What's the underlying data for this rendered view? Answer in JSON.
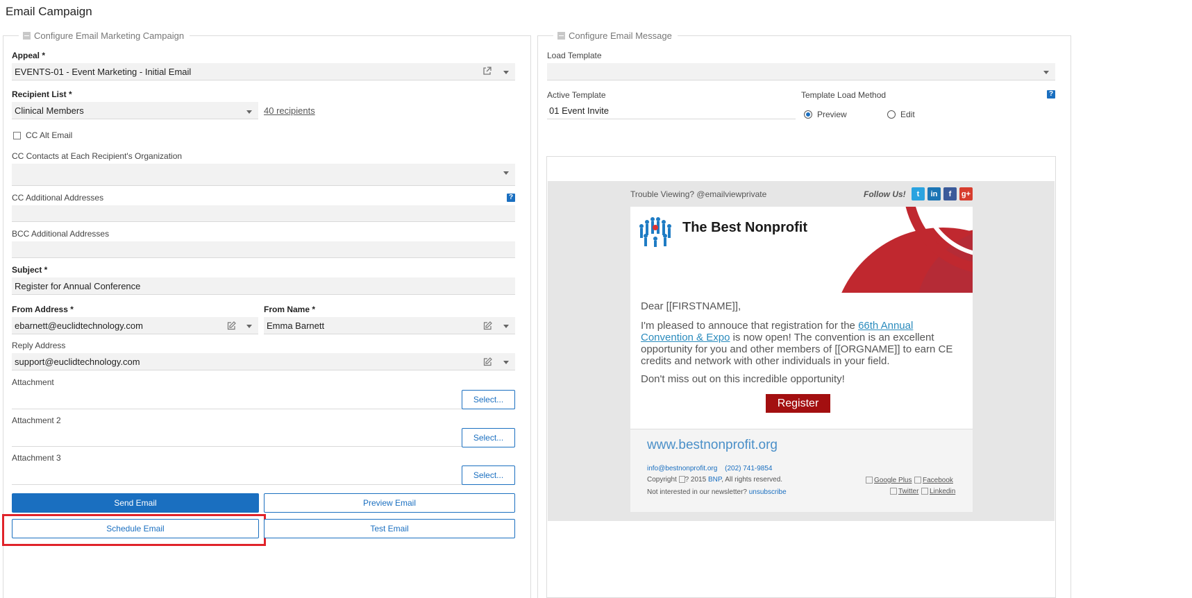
{
  "page_title": "Email Campaign",
  "left": {
    "legend": "Configure Email Marketing Campaign",
    "appeal": {
      "label": "Appeal *",
      "value": "EVENTS-01 - Event Marketing - Initial Email"
    },
    "recipient_list": {
      "label": "Recipient List *",
      "value": "Clinical Members",
      "count_link": "40 recipients"
    },
    "cc_alt_email": {
      "label": "CC Alt Email",
      "checked": false
    },
    "cc_contacts": {
      "label": "CC Contacts at Each Recipient's Organization",
      "value": ""
    },
    "cc_additional": {
      "label": "CC Additional Addresses",
      "value": ""
    },
    "bcc_additional": {
      "label": "BCC Additional Addresses",
      "value": ""
    },
    "subject": {
      "label": "Subject *",
      "value": "Register for Annual Conference"
    },
    "from_address": {
      "label": "From Address *",
      "value": "ebarnett@euclidtechnology.com"
    },
    "from_name": {
      "label": "From Name *",
      "value": "Emma Barnett"
    },
    "reply_address": {
      "label": "Reply Address",
      "value": "support@euclidtechnology.com"
    },
    "attachments": [
      {
        "label": "Attachment",
        "button": "Select..."
      },
      {
        "label": "Attachment 2",
        "button": "Select..."
      },
      {
        "label": "Attachment 3",
        "button": "Select..."
      }
    ],
    "buttons": {
      "send": "Send Email",
      "preview": "Preview Email",
      "schedule": "Schedule Email",
      "test": "Test Email"
    }
  },
  "right": {
    "legend": "Configure Email Message",
    "load_template": {
      "label": "Load Template",
      "value": ""
    },
    "active_template": {
      "label": "Active Template",
      "value": "01 Event Invite"
    },
    "load_method": {
      "label": "Template Load Method",
      "options": [
        "Preview",
        "Edit"
      ],
      "selected": "Preview"
    }
  },
  "email": {
    "trouble": "Trouble Viewing? @emailviewprivate",
    "follow": "Follow Us!",
    "social": [
      {
        "name": "twitter-icon",
        "glyph": "t",
        "color": "#2aa3e0"
      },
      {
        "name": "linkedin-icon",
        "glyph": "in",
        "color": "#1b75b5"
      },
      {
        "name": "facebook-icon",
        "glyph": "f",
        "color": "#3b5b9a"
      },
      {
        "name": "google-plus-icon",
        "glyph": "g+",
        "color": "#d73d2e"
      }
    ],
    "org_name": "The Best Nonprofit",
    "greeting": "Dear [[FIRSTNAME]],",
    "para1_before": "I'm pleased to annouce that registration for the ",
    "para1_link": "66th Annual Convention & Expo",
    "para1_after": " is now open! The convention is an excellent opportunity for you and other members of [[ORGNAME]] to earn CE credits and network with other individuals in your field.",
    "para2": "Don't miss out on this incredible opportunity!",
    "register": "Register",
    "website": "www.bestnonprofit.org",
    "contact_email": "info@bestnonprofit.org",
    "contact_phone": "(202) 741-9854",
    "copyright_before": "Copyright ",
    "copyright_mid": "? 2015 ",
    "copyright_org": "BNP",
    "copyright_after": ", All rights reserved.",
    "unsub_text": "Not interested in our newsletter? ",
    "unsub_link": "unsubscribe",
    "footer_links": [
      "Google Plus",
      "Facebook",
      "Twitter",
      "Linkedin"
    ],
    "brand_red": "#a30f10"
  },
  "colors": {
    "primary": "#1a6fc0",
    "highlight": "#e0232a"
  }
}
